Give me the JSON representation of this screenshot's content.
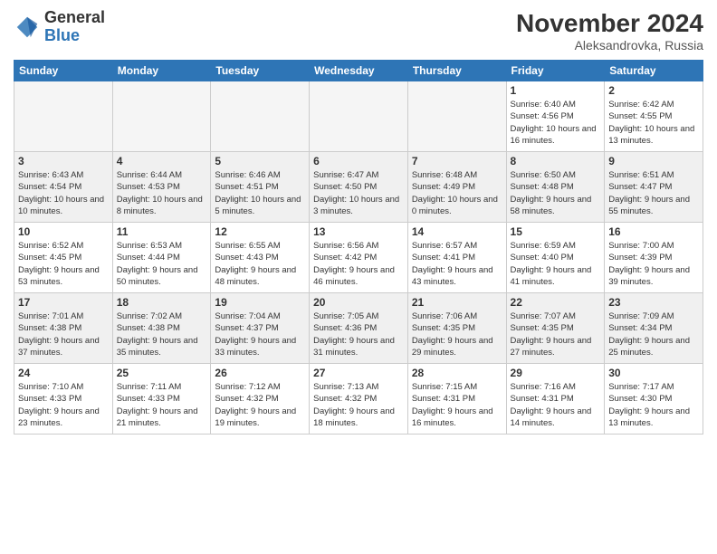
{
  "header": {
    "logo_line1": "General",
    "logo_line2": "Blue",
    "month": "November 2024",
    "location": "Aleksandrovka, Russia"
  },
  "days_of_week": [
    "Sunday",
    "Monday",
    "Tuesday",
    "Wednesday",
    "Thursday",
    "Friday",
    "Saturday"
  ],
  "weeks": [
    [
      {
        "day": "",
        "empty": true
      },
      {
        "day": "",
        "empty": true
      },
      {
        "day": "",
        "empty": true
      },
      {
        "day": "",
        "empty": true
      },
      {
        "day": "",
        "empty": true
      },
      {
        "day": "1",
        "sunrise": "Sunrise: 6:40 AM",
        "sunset": "Sunset: 4:56 PM",
        "daylight": "Daylight: 10 hours and 16 minutes."
      },
      {
        "day": "2",
        "sunrise": "Sunrise: 6:42 AM",
        "sunset": "Sunset: 4:55 PM",
        "daylight": "Daylight: 10 hours and 13 minutes."
      }
    ],
    [
      {
        "day": "3",
        "sunrise": "Sunrise: 6:43 AM",
        "sunset": "Sunset: 4:54 PM",
        "daylight": "Daylight: 10 hours and 10 minutes."
      },
      {
        "day": "4",
        "sunrise": "Sunrise: 6:44 AM",
        "sunset": "Sunset: 4:53 PM",
        "daylight": "Daylight: 10 hours and 8 minutes."
      },
      {
        "day": "5",
        "sunrise": "Sunrise: 6:46 AM",
        "sunset": "Sunset: 4:51 PM",
        "daylight": "Daylight: 10 hours and 5 minutes."
      },
      {
        "day": "6",
        "sunrise": "Sunrise: 6:47 AM",
        "sunset": "Sunset: 4:50 PM",
        "daylight": "Daylight: 10 hours and 3 minutes."
      },
      {
        "day": "7",
        "sunrise": "Sunrise: 6:48 AM",
        "sunset": "Sunset: 4:49 PM",
        "daylight": "Daylight: 10 hours and 0 minutes."
      },
      {
        "day": "8",
        "sunrise": "Sunrise: 6:50 AM",
        "sunset": "Sunset: 4:48 PM",
        "daylight": "Daylight: 9 hours and 58 minutes."
      },
      {
        "day": "9",
        "sunrise": "Sunrise: 6:51 AM",
        "sunset": "Sunset: 4:47 PM",
        "daylight": "Daylight: 9 hours and 55 minutes."
      }
    ],
    [
      {
        "day": "10",
        "sunrise": "Sunrise: 6:52 AM",
        "sunset": "Sunset: 4:45 PM",
        "daylight": "Daylight: 9 hours and 53 minutes."
      },
      {
        "day": "11",
        "sunrise": "Sunrise: 6:53 AM",
        "sunset": "Sunset: 4:44 PM",
        "daylight": "Daylight: 9 hours and 50 minutes."
      },
      {
        "day": "12",
        "sunrise": "Sunrise: 6:55 AM",
        "sunset": "Sunset: 4:43 PM",
        "daylight": "Daylight: 9 hours and 48 minutes."
      },
      {
        "day": "13",
        "sunrise": "Sunrise: 6:56 AM",
        "sunset": "Sunset: 4:42 PM",
        "daylight": "Daylight: 9 hours and 46 minutes."
      },
      {
        "day": "14",
        "sunrise": "Sunrise: 6:57 AM",
        "sunset": "Sunset: 4:41 PM",
        "daylight": "Daylight: 9 hours and 43 minutes."
      },
      {
        "day": "15",
        "sunrise": "Sunrise: 6:59 AM",
        "sunset": "Sunset: 4:40 PM",
        "daylight": "Daylight: 9 hours and 41 minutes."
      },
      {
        "day": "16",
        "sunrise": "Sunrise: 7:00 AM",
        "sunset": "Sunset: 4:39 PM",
        "daylight": "Daylight: 9 hours and 39 minutes."
      }
    ],
    [
      {
        "day": "17",
        "sunrise": "Sunrise: 7:01 AM",
        "sunset": "Sunset: 4:38 PM",
        "daylight": "Daylight: 9 hours and 37 minutes."
      },
      {
        "day": "18",
        "sunrise": "Sunrise: 7:02 AM",
        "sunset": "Sunset: 4:38 PM",
        "daylight": "Daylight: 9 hours and 35 minutes."
      },
      {
        "day": "19",
        "sunrise": "Sunrise: 7:04 AM",
        "sunset": "Sunset: 4:37 PM",
        "daylight": "Daylight: 9 hours and 33 minutes."
      },
      {
        "day": "20",
        "sunrise": "Sunrise: 7:05 AM",
        "sunset": "Sunset: 4:36 PM",
        "daylight": "Daylight: 9 hours and 31 minutes."
      },
      {
        "day": "21",
        "sunrise": "Sunrise: 7:06 AM",
        "sunset": "Sunset: 4:35 PM",
        "daylight": "Daylight: 9 hours and 29 minutes."
      },
      {
        "day": "22",
        "sunrise": "Sunrise: 7:07 AM",
        "sunset": "Sunset: 4:35 PM",
        "daylight": "Daylight: 9 hours and 27 minutes."
      },
      {
        "day": "23",
        "sunrise": "Sunrise: 7:09 AM",
        "sunset": "Sunset: 4:34 PM",
        "daylight": "Daylight: 9 hours and 25 minutes."
      }
    ],
    [
      {
        "day": "24",
        "sunrise": "Sunrise: 7:10 AM",
        "sunset": "Sunset: 4:33 PM",
        "daylight": "Daylight: 9 hours and 23 minutes."
      },
      {
        "day": "25",
        "sunrise": "Sunrise: 7:11 AM",
        "sunset": "Sunset: 4:33 PM",
        "daylight": "Daylight: 9 hours and 21 minutes."
      },
      {
        "day": "26",
        "sunrise": "Sunrise: 7:12 AM",
        "sunset": "Sunset: 4:32 PM",
        "daylight": "Daylight: 9 hours and 19 minutes."
      },
      {
        "day": "27",
        "sunrise": "Sunrise: 7:13 AM",
        "sunset": "Sunset: 4:32 PM",
        "daylight": "Daylight: 9 hours and 18 minutes."
      },
      {
        "day": "28",
        "sunrise": "Sunrise: 7:15 AM",
        "sunset": "Sunset: 4:31 PM",
        "daylight": "Daylight: 9 hours and 16 minutes."
      },
      {
        "day": "29",
        "sunrise": "Sunrise: 7:16 AM",
        "sunset": "Sunset: 4:31 PM",
        "daylight": "Daylight: 9 hours and 14 minutes."
      },
      {
        "day": "30",
        "sunrise": "Sunrise: 7:17 AM",
        "sunset": "Sunset: 4:30 PM",
        "daylight": "Daylight: 9 hours and 13 minutes."
      }
    ]
  ]
}
